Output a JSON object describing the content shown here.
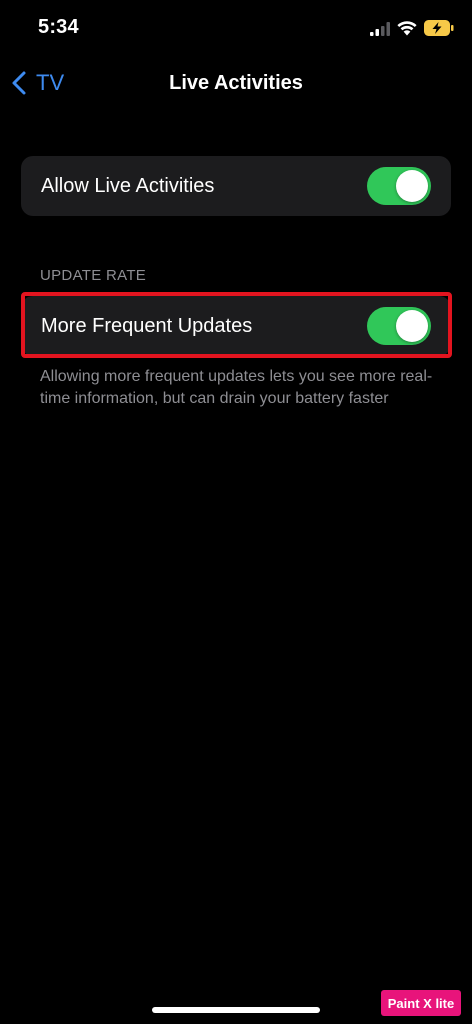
{
  "status_bar": {
    "time": "5:34",
    "icons": [
      "cellular-signal-icon",
      "wifi-icon",
      "battery-charging-icon"
    ],
    "battery_color": "#f7c948"
  },
  "nav": {
    "back_label": "TV",
    "title": "Live Activities",
    "accent_color": "#3e8bf0"
  },
  "allow_group": {
    "label": "Allow Live Activities",
    "enabled": true
  },
  "update_rate": {
    "section_header": "UPDATE RATE",
    "label": "More Frequent Updates",
    "enabled": true,
    "footer": "Allowing more frequent updates lets you see more real-time information, but can drain your battery faster"
  },
  "toggle_on_color": "#30c759",
  "highlight_color": "#e3141f",
  "watermark": "Paint X lite"
}
